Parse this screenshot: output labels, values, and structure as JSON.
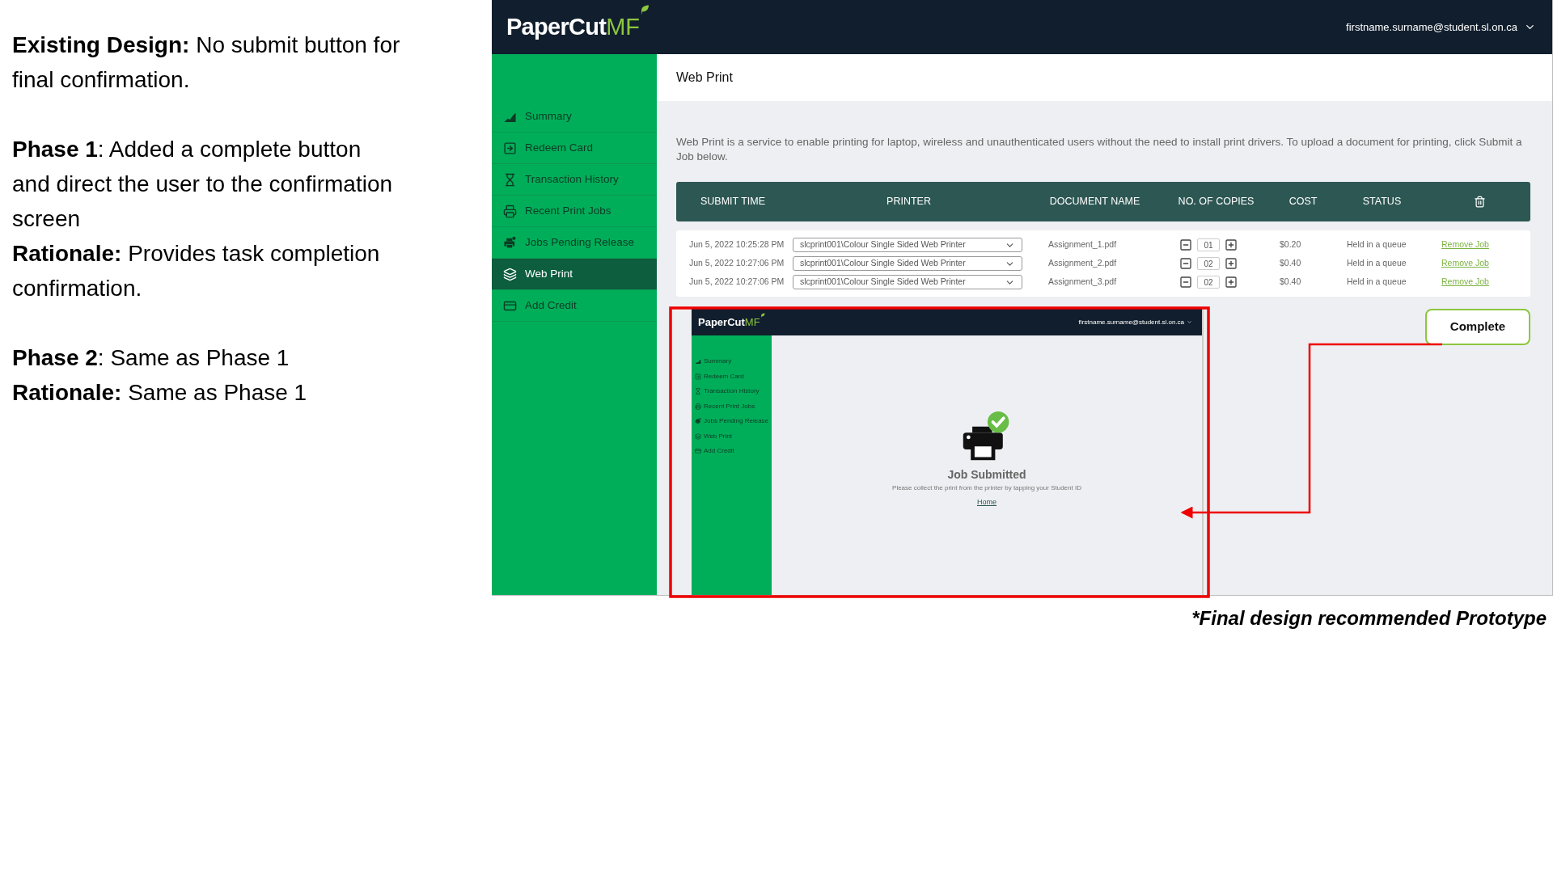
{
  "notes": [
    {
      "lines": [
        "**Existing Design:** No submit button for final confirmation."
      ]
    },
    {
      "lines": [
        "**Phase 1**: Added a complete button and direct the user to the confirmation screen",
        "**Rationale:** Provides task completion confirmation."
      ]
    },
    {
      "lines": [
        "**Phase 2**: Same as Phase 1",
        "**Rationale:** Same as Phase 1"
      ]
    }
  ],
  "app": {
    "logo": {
      "name": "PaperCut",
      "suffix": "MF"
    },
    "user_menu": "firstname.surname@student.sl.on.ca",
    "sidebar": {
      "items": [
        {
          "label": "Summary",
          "selected": false
        },
        {
          "label": "Redeem Card",
          "selected": false
        },
        {
          "label": "Transaction History",
          "selected": false
        },
        {
          "label": "Recent Print Jobs",
          "selected": false
        },
        {
          "label": "Jobs Pending Release",
          "selected": false
        },
        {
          "label": "Web Print",
          "selected": true
        },
        {
          "label": "Add Credit",
          "selected": false
        }
      ]
    },
    "page_title": "Web Print",
    "description": "Web Print is a service to enable printing for laptop, wireless and unauthenticated users without the need to install print drivers. To upload a document for printing, click Submit a Job below.",
    "table": {
      "columns": [
        "SUBMIT TIME",
        "PRINTER",
        "DOCUMENT NAME",
        "NO. OF COPIES",
        "COST",
        "STATUS"
      ],
      "rows": [
        {
          "submit_time": "Jun 5, 2022 10:25:28 PM",
          "printer": "slcprint001\\Colour Single Sided Web Printer",
          "document": "Assignment_1.pdf",
          "copies": "01",
          "cost": "$0.20",
          "status": "Held in a queue",
          "action": "Remove Job"
        },
        {
          "submit_time": "Jun 5, 2022 10:27:06 PM",
          "printer": "slcprint001\\Colour Single Sided Web Printer",
          "document": "Assignment_2.pdf",
          "copies": "02",
          "cost": "$0.40",
          "status": "Held in a queue",
          "action": "Remove Job"
        },
        {
          "submit_time": "Jun 5, 2022 10:27:06 PM",
          "printer": "slcprint001\\Colour Single Sided Web Printer",
          "document": "Assignment_3.pdf",
          "copies": "02",
          "cost": "$0.40",
          "status": "Held in a queue",
          "action": "Remove Job"
        }
      ]
    },
    "preview": {
      "logo": {
        "name": "PaperCut",
        "suffix": "MF"
      },
      "user_menu": "firstname.surname@student.sl.on.ca",
      "sidebar": {
        "items": [
          "Summary",
          "Redeem Card",
          "Transaction History",
          "Recent Print Jobs",
          "Jobs Pending Release",
          "Web Print",
          "Add Credit"
        ]
      },
      "title": "Job Submitted",
      "message": "Please collect the print from the printer by tapping your Student ID",
      "link": "Home"
    },
    "complete_button": "Complete"
  },
  "caption": "*Final design recommended Prototype"
}
